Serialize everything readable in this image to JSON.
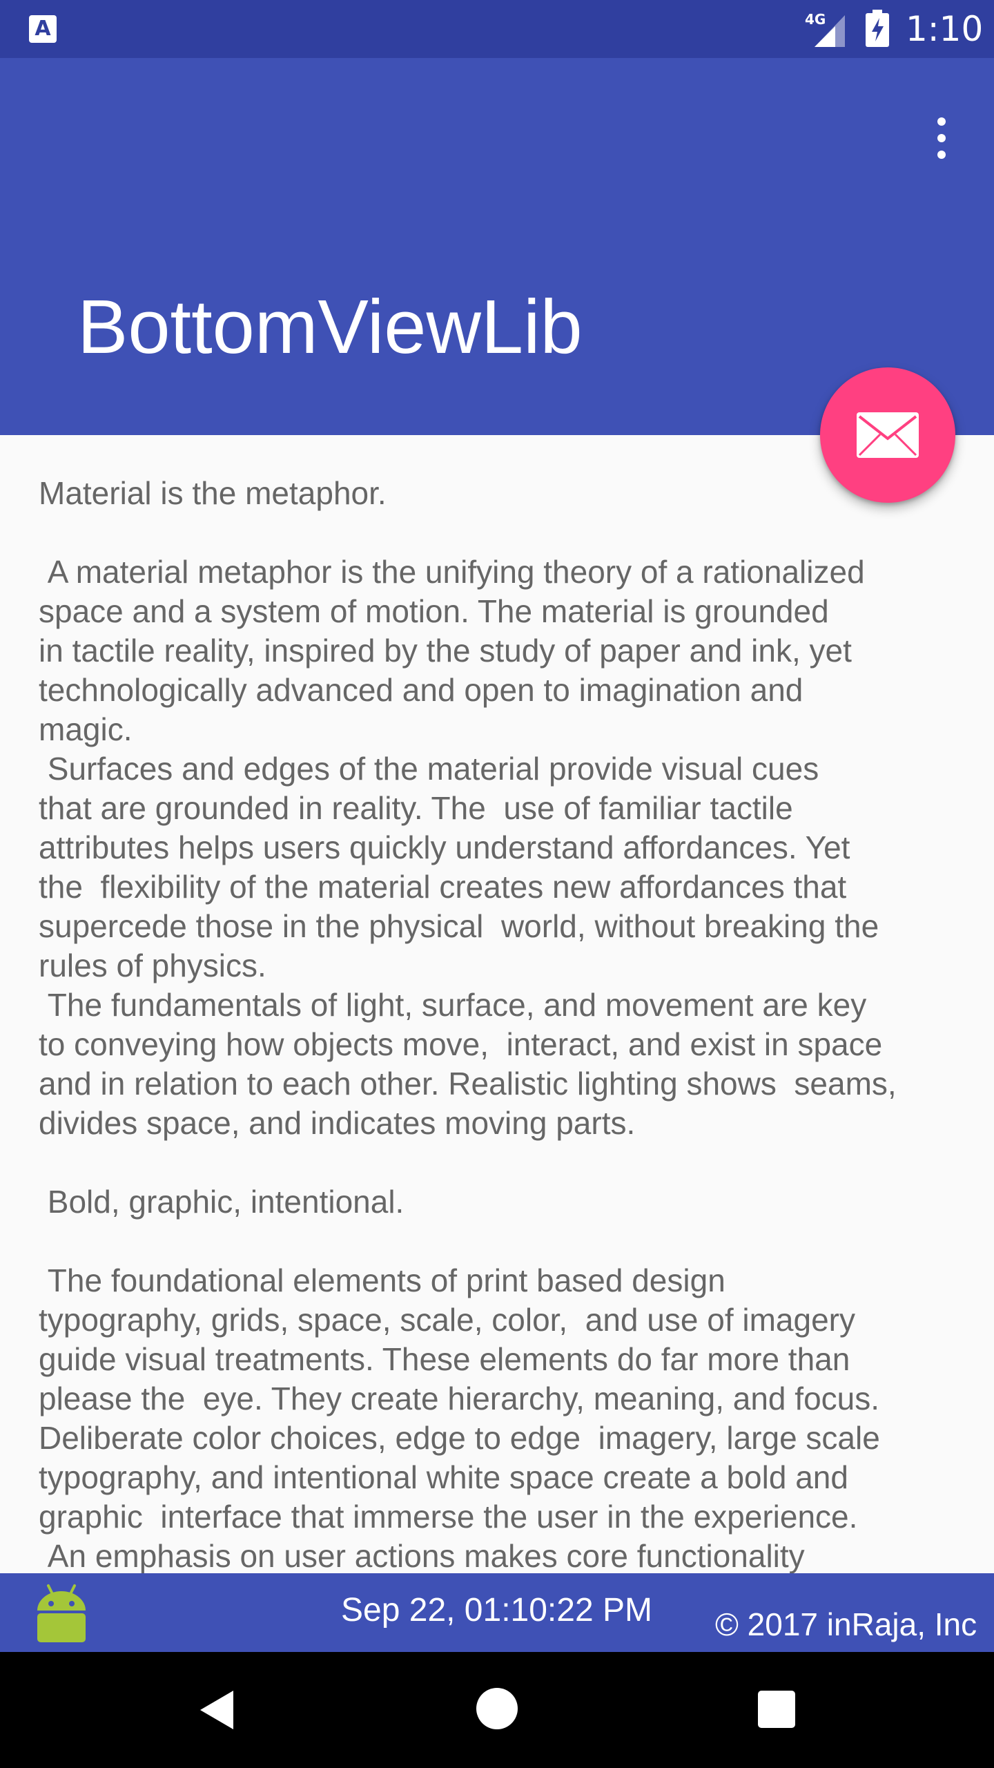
{
  "status_bar": {
    "left_icon": "A",
    "left_icon_name": "text-notification-icon",
    "network": "4G",
    "signal_icon": "signal-icon",
    "battery_icon": "battery-charging-icon",
    "time": "1:10",
    "background": "#303f9f"
  },
  "app_bar": {
    "title": "BottomViewLib",
    "menu_icon": "more-vert-icon",
    "background": "#3f51b5"
  },
  "fab": {
    "icon": "mail-icon",
    "color": "#ff4081"
  },
  "content": {
    "text": "Material is the metaphor.\n\n A material metaphor is the unifying theory of a rationalized\nspace and a system of motion. The material is grounded\nin tactile reality, inspired by the study of paper and ink, yet\ntechnologically advanced and open to imagination and\nmagic.\n Surfaces and edges of the material provide visual cues\nthat are grounded in reality. The  use of familiar tactile\nattributes helps users quickly understand affordances. Yet\nthe  flexibility of the material creates new affordances that\nsupercede those in the physical  world, without breaking the\nrules of physics.\n The fundamentals of light, surface, and movement are key\nto conveying how objects move,  interact, and exist in space\nand in relation to each other. Realistic lighting shows  seams,\ndivides space, and indicates moving parts.\n\n Bold, graphic, intentional.\n\n The foundational elements of print based design\ntypography, grids, space, scale, color,  and use of imagery\nguide visual treatments. These elements do far more than\nplease the  eye. They create hierarchy, meaning, and focus.\nDeliberate color choices, edge to edge  imagery, large scale\ntypography, and intentional white space create a bold and\ngraphic  interface that immerse the user in the experience.\n An emphasis on user actions makes core functionality"
  },
  "bottom_bar": {
    "icon": "android-icon",
    "timestamp": "Sep 22, 01:10:22 PM",
    "copyright": "© 2017 inRaja, Inc",
    "background": "#3f51b5"
  },
  "nav_bar": {
    "back_icon": "back-icon",
    "home_icon": "home-icon",
    "recents_icon": "recents-icon"
  }
}
